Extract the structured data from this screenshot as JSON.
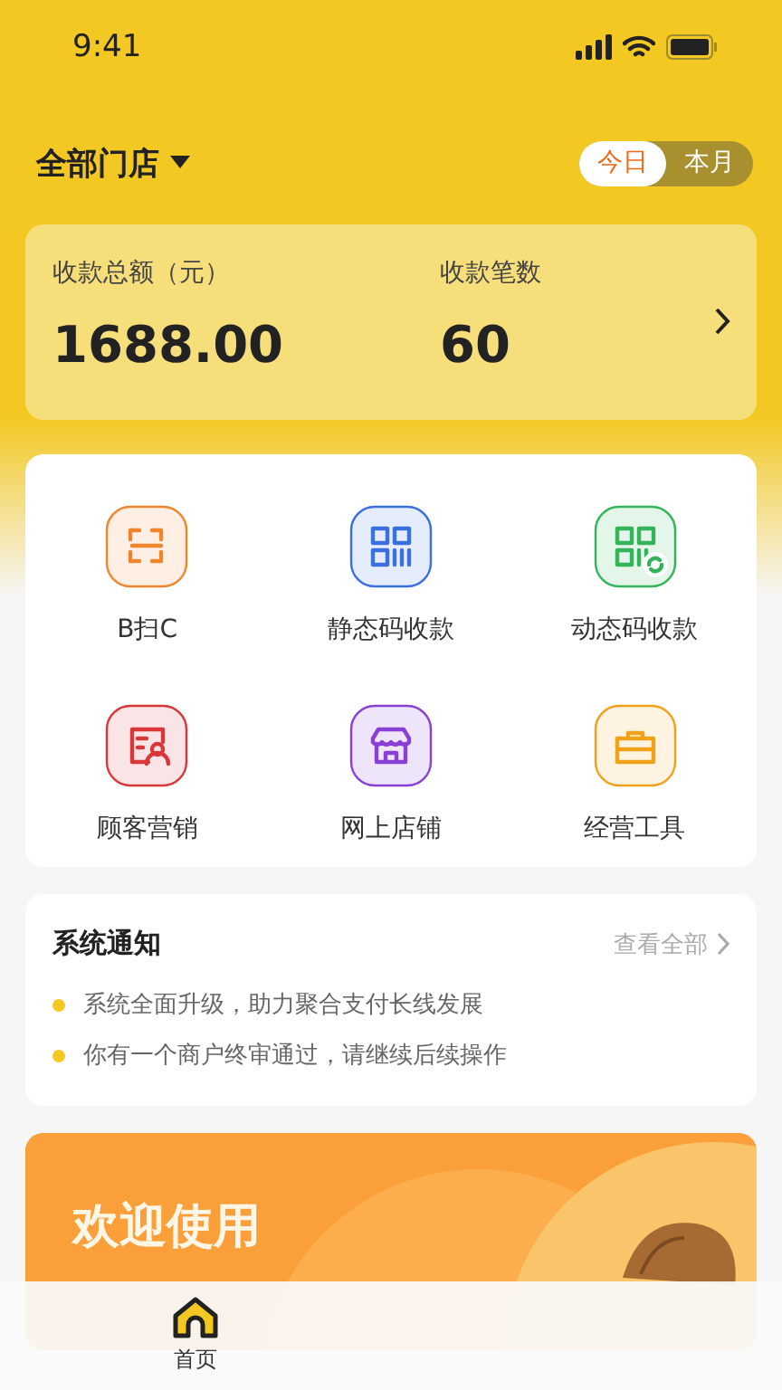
{
  "status_bar": {
    "time": "9:41"
  },
  "header": {
    "store_picker": "全部门店",
    "periods": [
      {
        "label": "今日",
        "selected": true
      },
      {
        "label": "本月",
        "selected": false
      }
    ]
  },
  "summary": {
    "items": [
      {
        "label": "收款总额（元）",
        "value": "1688.00"
      },
      {
        "label": "收款笔数",
        "value": "60"
      }
    ]
  },
  "features": [
    {
      "label": "B扫C",
      "kind": "scan",
      "color": "#f0862c"
    },
    {
      "label": "静态码收款",
      "kind": "qr",
      "color": "#3a6fe0"
    },
    {
      "label": "动态码收款",
      "kind": "qr-refresh",
      "color": "#34b45a"
    },
    {
      "label": "顾客营销",
      "kind": "customer",
      "color": "#d9383a"
    },
    {
      "label": "网上店铺",
      "kind": "store",
      "color": "#8a3fd6"
    },
    {
      "label": "经营工具",
      "kind": "toolbox",
      "color": "#f0a21a"
    }
  ],
  "notices": {
    "title": "系统通知",
    "view_all": "查看全部",
    "items": [
      "系统全面升级，助力聚合支付长线发展",
      "你有一个商户终审通过，请继续后续操作"
    ]
  },
  "banner": {
    "title": "欢迎使用"
  },
  "tab_bar": [
    {
      "label": "首页",
      "selected": true
    }
  ]
}
